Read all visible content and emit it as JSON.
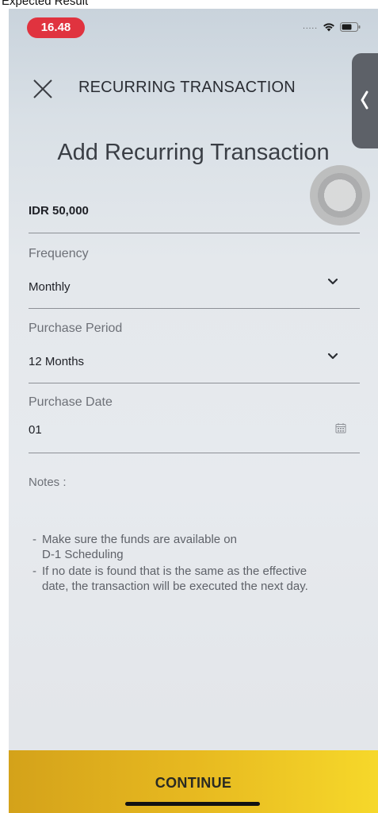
{
  "caption": "Expected Result",
  "status_bar": {
    "time": "16.48",
    "dots": "....."
  },
  "header": {
    "title": "RECURRING TRANSACTION"
  },
  "page": {
    "title": "Add Recurring Transaction"
  },
  "amount": "IDR 50,000",
  "fields": [
    {
      "label": "Frequency",
      "value": "Monthly",
      "icon": "chevron-down-icon"
    },
    {
      "label": "Purchase Period",
      "value": "12 Months",
      "icon": "chevron-down-icon"
    },
    {
      "label": "Purchase Date",
      "value": "01",
      "icon": "calendar-icon"
    }
  ],
  "notes": {
    "label": "Notes :",
    "items": [
      {
        "line1": "Make sure the funds are available on",
        "line2": "D-1 Scheduling"
      },
      {
        "line1": "If no date is found that is the same as the effective",
        "line2": "date, the transaction will be executed the next day."
      }
    ]
  },
  "footer": {
    "continue_label": "CONTINUE"
  },
  "colors": {
    "time_pill": "#e0333f",
    "button_start": "#d4a21a",
    "button_end": "#f6d82a",
    "side_tab": "#5d6168"
  }
}
